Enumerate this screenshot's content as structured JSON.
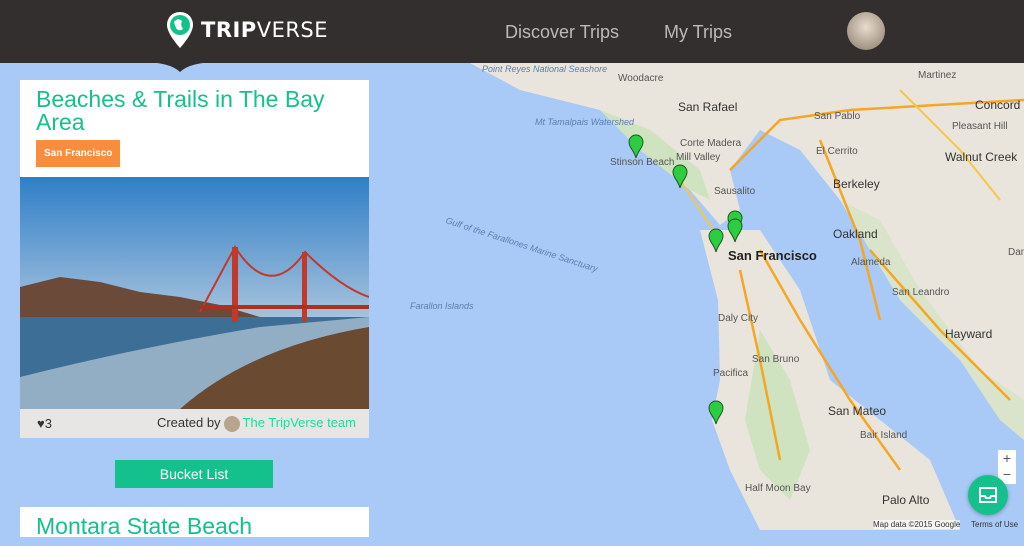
{
  "header": {
    "logo_bold": "TRIP",
    "logo_light": "VERSE",
    "nav": [
      "Discover Trips",
      "My Trips"
    ]
  },
  "trip_card": {
    "title": "Beaches & Trails in The Bay Area",
    "tag": "San Francisco",
    "likes": "3",
    "created_by_label": "Created by",
    "creator": "The TripVerse team"
  },
  "bucket_button": "Bucket List",
  "next_card": {
    "title": "Montara State Beach"
  },
  "map": {
    "labels": [
      "Point Reyes National Seashore",
      "Woodacre",
      "Martinez",
      "Concord",
      "San Rafael",
      "San Pablo",
      "Pleasant Hill",
      "Mt Tamalpais Watershed",
      "Corte Madera",
      "El Cerrito",
      "Walnut Creek",
      "Stinson Beach",
      "Mill Valley",
      "Berkeley",
      "Sausalito",
      "Gulf of the Farallones Marine Sanctuary",
      "Oakland",
      "Danville",
      "San Francisco",
      "Alameda",
      "Farallon Islands",
      "San Leandro",
      "Daly City",
      "Hayward",
      "San Bruno",
      "Pacifica",
      "San Mateo",
      "Bair Island",
      "Half Moon Bay",
      "Palo Alto"
    ],
    "zoom_in": "+",
    "zoom_out": "−",
    "attribution": "Map data ©2015 Google",
    "terms": "Terms of Use",
    "marker_color": "#2ecc40"
  },
  "colors": {
    "accent": "#14c08b",
    "tag": "#f88d3e",
    "header": "#322f2e"
  }
}
